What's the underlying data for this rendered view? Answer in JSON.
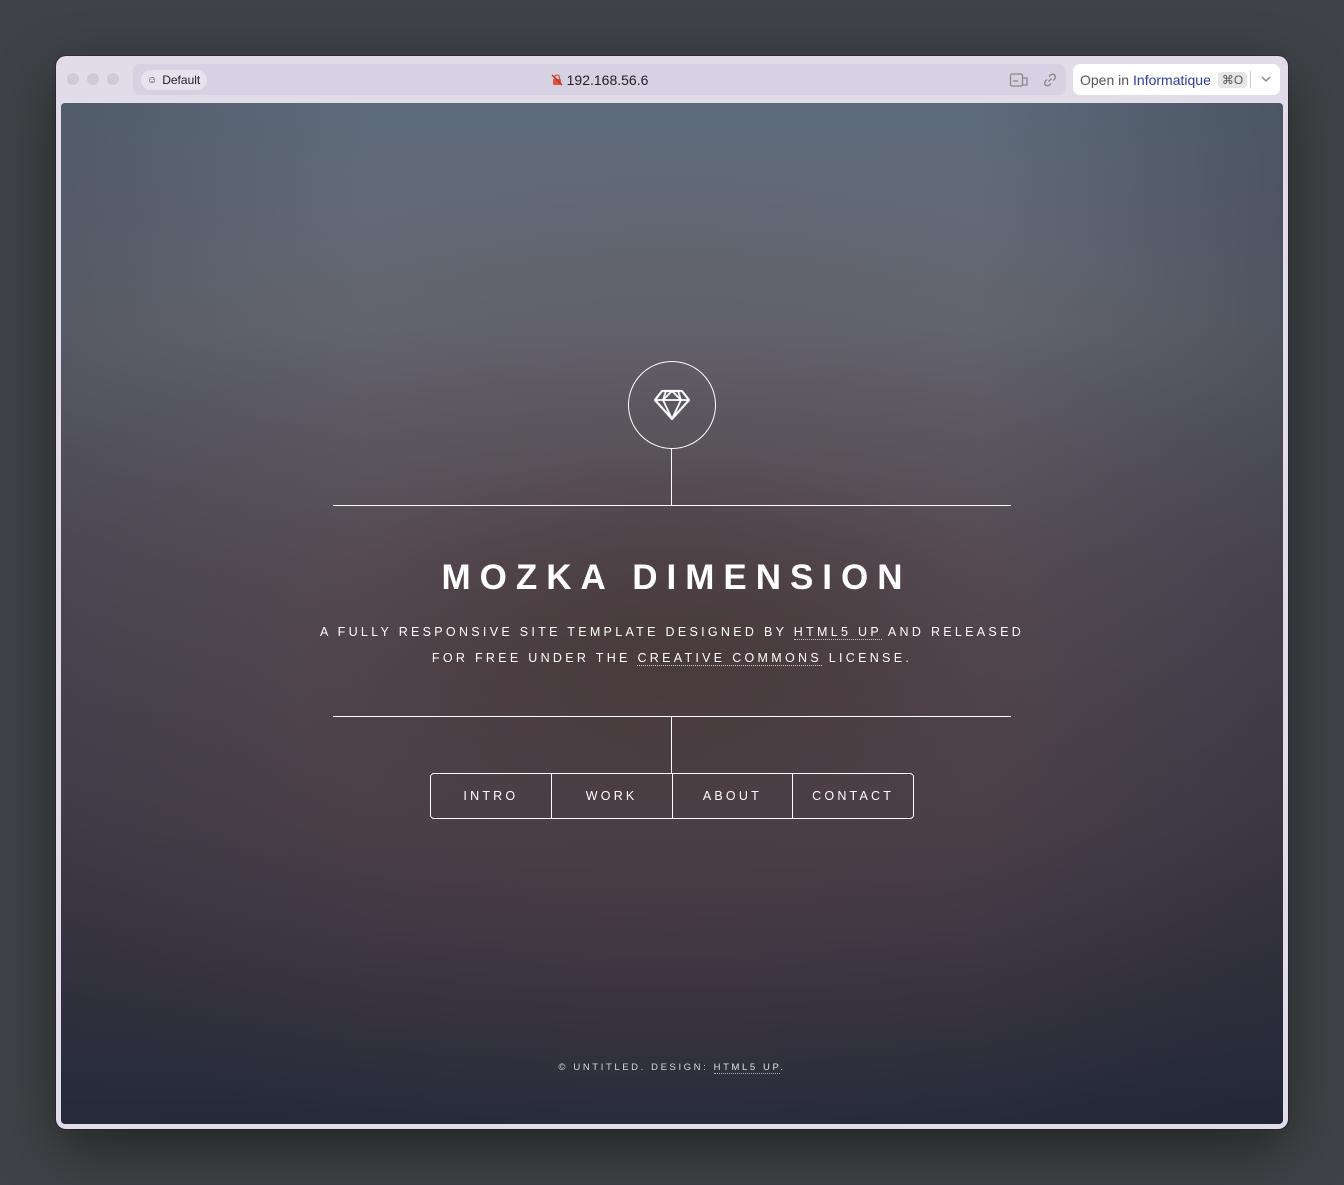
{
  "browser": {
    "profile_label": "Default",
    "url": "192.168.56.6",
    "open_in_prefix": "Open in",
    "open_in_app": "Informatique",
    "open_in_shortcut": "⌘O"
  },
  "site": {
    "title": "MOZKA DIMENSION",
    "subtitle_part1": "A FULLY RESPONSIVE SITE TEMPLATE DESIGNED BY ",
    "subtitle_link1": "HTML5 UP",
    "subtitle_part2": " AND RELEASED",
    "subtitle_part3": "FOR FREE UNDER THE ",
    "subtitle_link2": "CREATIVE COMMONS",
    "subtitle_part4": " LICENSE.",
    "nav": [
      "INTRO",
      "WORK",
      "ABOUT",
      "CONTACT"
    ],
    "footer_text": "© UNTITLED. DESIGN: ",
    "footer_link": "HTML5 UP",
    "footer_end": "."
  },
  "icons": {
    "logo": "diamond-icon",
    "insecure": "insecure-lock-icon",
    "reader": "reader-mode-icon",
    "link": "link-icon",
    "chevron": "chevron-down-icon"
  }
}
